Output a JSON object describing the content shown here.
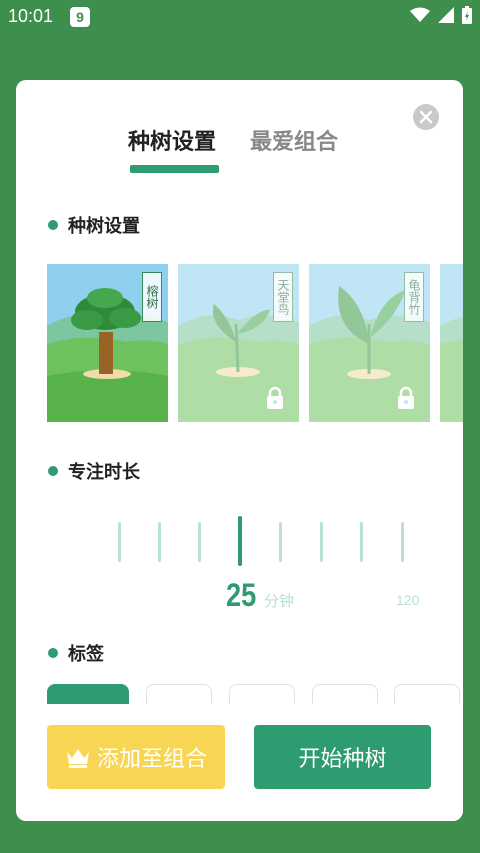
{
  "status_bar": {
    "time": "10:01",
    "app_icon_glyph": "9"
  },
  "tabs": [
    {
      "label": "种树设置",
      "active": true
    },
    {
      "label": "最爱组合",
      "active": false
    }
  ],
  "sections": {
    "tree_setting": "种树设置",
    "focus_duration": "专注时长",
    "tags": "标签"
  },
  "trees": [
    {
      "name": "榕树",
      "locked": false
    },
    {
      "name": "天堂鸟",
      "locked": true
    },
    {
      "name": "龟背竹",
      "locked": true
    },
    {
      "name": "",
      "locked": true
    }
  ],
  "duration": {
    "value": "25",
    "unit": "分钟",
    "max_label": "120"
  },
  "buttons": {
    "add_to_combo": "添加至组合",
    "start_planting": "开始种树"
  },
  "colors": {
    "background": "#3E8E4D",
    "accent": "#2E9B70",
    "add_button": "#F9D554"
  }
}
